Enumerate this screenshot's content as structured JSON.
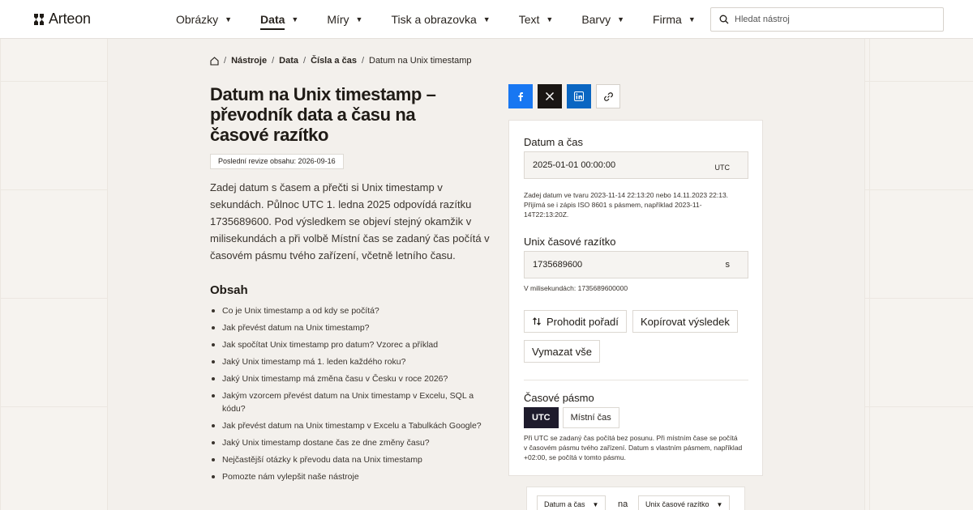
{
  "brand": {
    "name": "Arteon"
  },
  "nav": {
    "items": [
      {
        "label": "Obrázky",
        "active": false
      },
      {
        "label": "Data",
        "active": true
      },
      {
        "label": "Míry",
        "active": false
      },
      {
        "label": "Tisk a obrazovka",
        "active": false
      },
      {
        "label": "Text",
        "active": false
      },
      {
        "label": "Barvy",
        "active": false
      },
      {
        "label": "Firma",
        "active": false
      }
    ]
  },
  "search": {
    "placeholder": "Hledat nástroj"
  },
  "breadcrumb": {
    "items": [
      "Nástroje",
      "Data",
      "Čísla a čas"
    ],
    "current": "Datum na Unix timestamp"
  },
  "page": {
    "title": "Datum na Unix timestamp – převodník data a času na časové razítko",
    "revision": "Poslední revize obsahu: 2026-09-16",
    "intro": "Zadej datum s časem a přečti si Unix timestamp v sekundách. Půlnoc UTC 1. ledna 2025 odpovídá razítku 1735689600. Pod výsledkem se objeví stejný okamžik v milisekundách a při volbě Místní čas se zadaný čas počítá v časovém pásmu tvého zařízení, včetně letního času."
  },
  "toc": {
    "title": "Obsah",
    "items": [
      "Co je Unix timestamp a od kdy se počítá?",
      "Jak převést datum na Unix timestamp?",
      "Jak spočítat Unix timestamp pro datum? Vzorec a příklad",
      "Jaký Unix timestamp má 1. leden každého roku?",
      "Jaký Unix timestamp má změna času v Česku v roce 2026?",
      "Jakým vzorcem převést datum na Unix timestamp v Excelu, SQL a kódu?",
      "Jak převést datum na Unix timestamp v Excelu a Tabulkách Google?",
      "Jaký Unix timestamp dostane čas ze dne změny času?",
      "Nejčastější otázky k převodu data na Unix timestamp",
      "Pomozte nám vylepšit naše nástroje"
    ]
  },
  "calculator": {
    "datetime_label": "Datum a čas",
    "datetime_value": "2025-01-01 00:00:00",
    "datetime_unit": "UTC",
    "datetime_hint": "Zadej datum ve tvaru 2023-11-14 22:13:20 nebo 14.11.2023 22:13. Přijímá se i zápis ISO 8601 s pásmem, například 2023-11-14T22:13:20Z.",
    "timestamp_label": "Unix časové razítko",
    "timestamp_value": "1735689600",
    "timestamp_unit": "s",
    "ms_hint": "V milisekundách: 1735689600000",
    "swap_label": "Prohodit pořadí",
    "copy_label": "Kopírovat výsledek",
    "clear_label": "Vymazat vše",
    "tz_label": "Časové pásmo",
    "tz_options": [
      "UTC",
      "Místní čas"
    ],
    "tz_selected": "UTC",
    "tz_hint": "Při UTC se zadaný čas počítá bez posunu. Při místním čase se počítá v časovém pásmu tvého zařízení. Datum s vlastním pásmem, například +02:00, se počítá v tomto pásmu."
  },
  "converter": {
    "from": "Datum a čas",
    "connector": "na",
    "to": "Unix časové razítko"
  },
  "colors": {
    "facebook": "#1877f2",
    "x": "#1a1614",
    "linkedin": "#0a66c2",
    "selected": "#1e1b2c"
  }
}
